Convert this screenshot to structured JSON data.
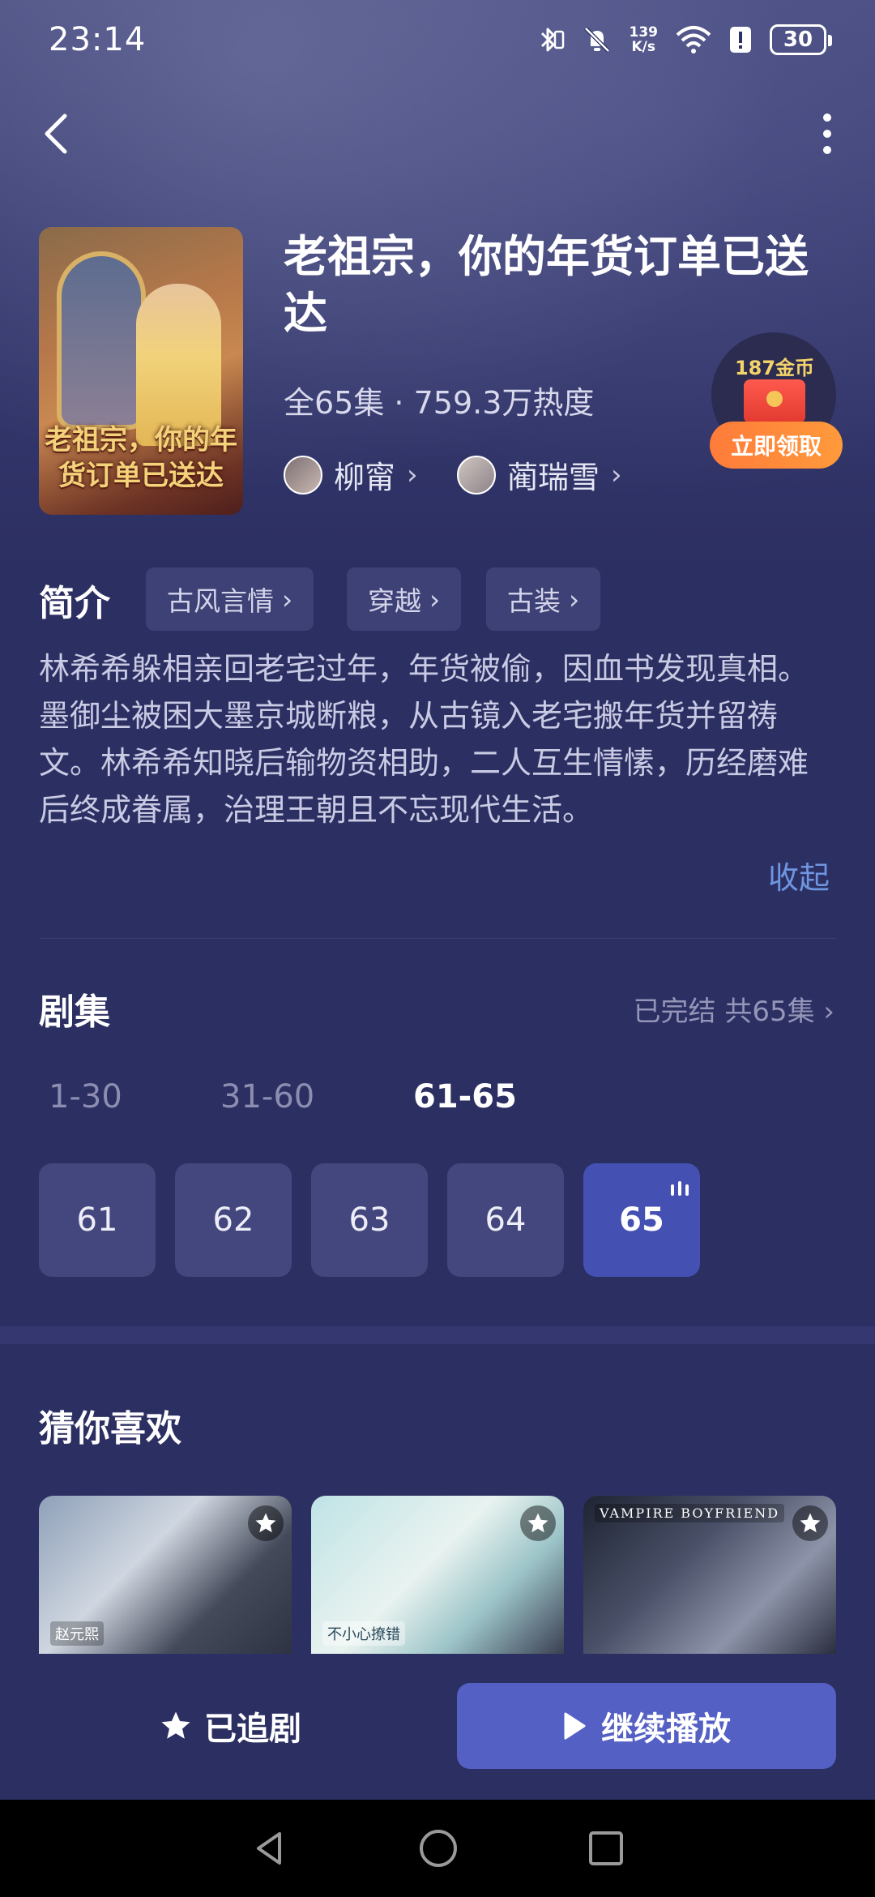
{
  "status_bar": {
    "time": "23:14",
    "net_speed_value": "139",
    "net_speed_unit": "K/s",
    "battery": "30"
  },
  "drama": {
    "title": "老祖宗，你的年货订单已送达",
    "poster_title": "老祖宗，你的年货订单已送达",
    "meta": "全65集 · 759.3万热度",
    "actors": [
      {
        "name": "柳甯",
        "chevron": "›"
      },
      {
        "name": "蔺瑞雪",
        "chevron": "›"
      }
    ]
  },
  "reward": {
    "coins": "187金币",
    "claim_label": "立即领取"
  },
  "intro": {
    "label": "简介",
    "tags": [
      {
        "label": "古风言情",
        "chevron": "›"
      },
      {
        "label": "穿越",
        "chevron": "›"
      },
      {
        "label": "古装",
        "chevron": "›"
      }
    ],
    "description": "林希希躲相亲回老宅过年，年货被偷，因血书发现真相。墨御尘被困大墨京城断粮，从古镜入老宅搬年货并留祷文。林希希知晓后输物资相助，二人互生情愫，历经磨难后终成眷属，治理王朝且不忘现代生活。",
    "collapse_label": "收起"
  },
  "episodes": {
    "label": "剧集",
    "status": "已完结 共65集 ›",
    "ranges": [
      "1-30",
      "31-60",
      "61-65"
    ],
    "active_range": "61-65",
    "items": [
      "61",
      "62",
      "63",
      "64",
      "65"
    ],
    "current": "65"
  },
  "recommend": {
    "label": "猜你喜欢",
    "cards": [
      {
        "tag": "赵元熙"
      },
      {
        "tag": "不小心撩错"
      },
      {
        "tag": "VAMPIRE BOYFRIEND"
      }
    ]
  },
  "actions": {
    "followed_label": "已追剧",
    "play_label": "继续播放"
  },
  "colors": {
    "background": "#2c2f62",
    "accent": "#5560c4",
    "active_episode": "#4451b2",
    "link": "#6f96e0",
    "coin": "#f5d36b",
    "claim_button": "#ff8a3a"
  },
  "icons": [
    "back-arrow-icon",
    "more-vertical-icon",
    "star-icon",
    "play-icon",
    "wifi-icon",
    "mute-icon",
    "bluetooth-icon"
  ]
}
